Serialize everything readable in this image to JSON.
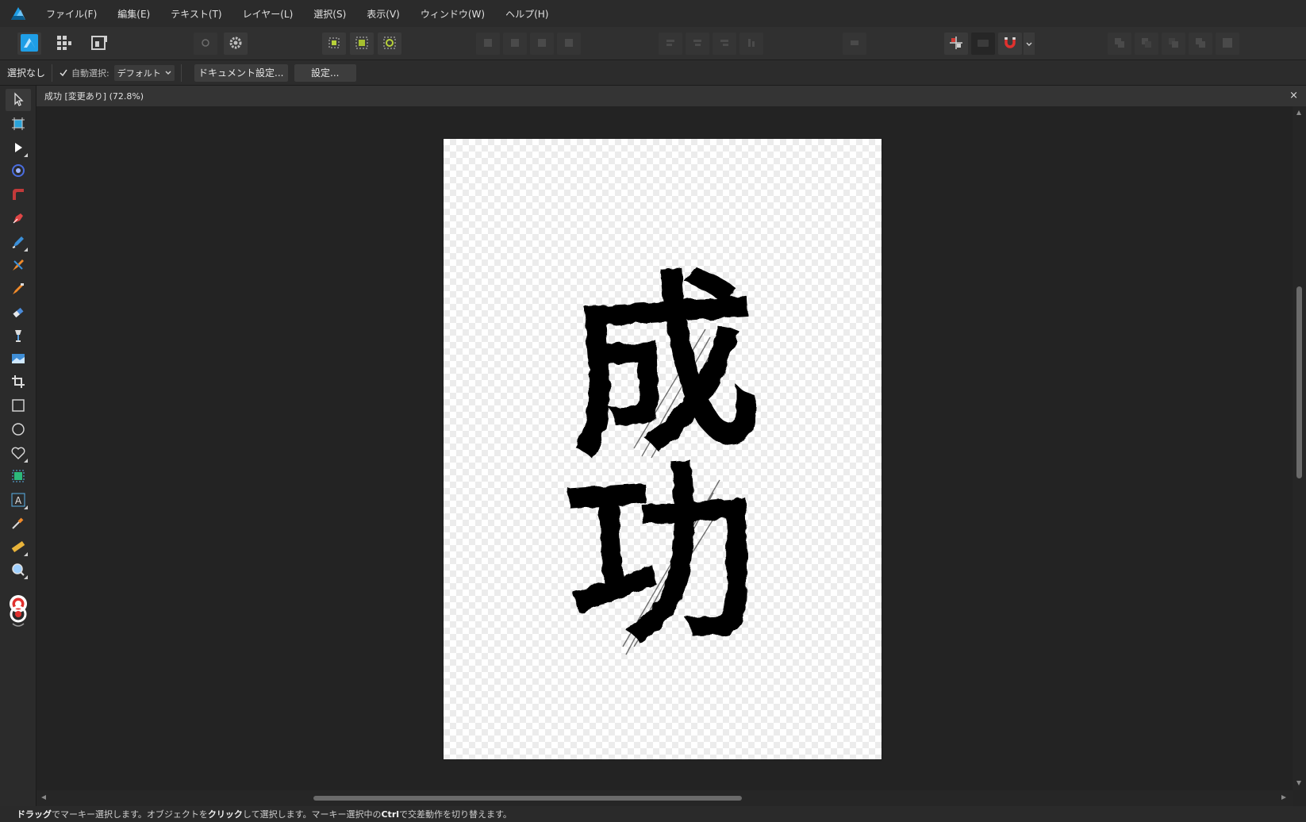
{
  "menu": {
    "items": [
      "ファイル(F)",
      "編集(E)",
      "テキスト(T)",
      "レイヤー(L)",
      "選択(S)",
      "表示(V)",
      "ウィンドウ(W)",
      "ヘルプ(H)"
    ]
  },
  "context": {
    "selection_status": "選択なし",
    "auto_select_label": "自動選択:",
    "auto_select_checked": true,
    "auto_select_value": "デフォルト",
    "document_settings_button": "ドキュメント設定...",
    "settings_button": "設定..."
  },
  "document": {
    "title": "成功 [変更あり] (72.8%)",
    "zoom_percent": 72.8,
    "modified": true,
    "close_glyph": "×",
    "artwork_text": "成功"
  },
  "status": {
    "s1": "ドラッグ",
    "s2": "でマーキー選択します。オブジェクトを",
    "s3": "クリック",
    "s4": "して選択します。マーキー選択中の",
    "s5": "Ctrl",
    "s6": "で交差動作を切り替えます。"
  },
  "scroll": {
    "vertical_position": 0.36,
    "horizontal_position": 0.33
  },
  "colors": {
    "accent": "#1f9ee6",
    "snapping": "#e0312e"
  },
  "icons": {
    "app": "affinity-designer-logo-icon",
    "personas": [
      "designer-persona-icon",
      "pixel-persona-icon",
      "export-persona-icon"
    ],
    "tools": [
      "move-tool-icon",
      "artboard-tool-icon",
      "node-tool-icon",
      "point-transform-tool-icon",
      "corner-tool-icon",
      "pen-tool-icon",
      "pencil-tool-icon",
      "vector-brush-tool-icon",
      "fill-tool-icon",
      "transparency-tool-icon",
      "paint-brush-tool-icon",
      "place-image-tool-icon",
      "crop-tool-icon",
      "rectangle-tool-icon",
      "ellipse-tool-icon",
      "heart-shape-tool-icon",
      "vector-crop-tool-icon",
      "artistic-text-tool-icon",
      "color-picker-tool-icon",
      "measure-tool-icon",
      "zoom-tool-icon"
    ]
  }
}
